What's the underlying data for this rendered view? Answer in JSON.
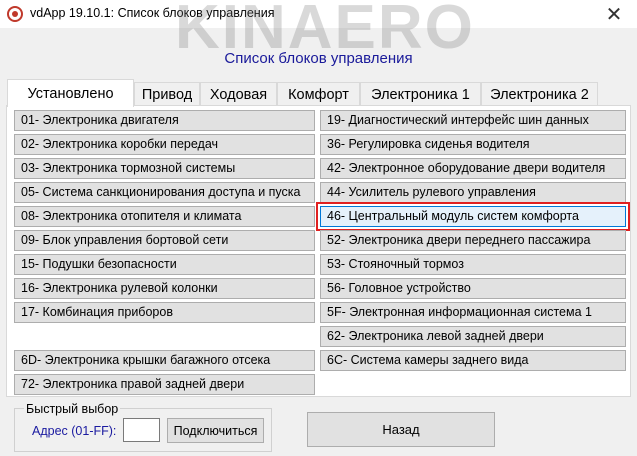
{
  "window": {
    "title": "vdApp 19.10.1:  Список блоков управления",
    "watermark": "KINAERO",
    "close_glyph": "✕"
  },
  "heading": "Список блоков управления",
  "tabs": [
    {
      "label": "Установлено",
      "active": true
    },
    {
      "label": "Привод",
      "active": false
    },
    {
      "label": "Ходовая",
      "active": false
    },
    {
      "label": "Комфорт",
      "active": false
    },
    {
      "label": "Электроника 1",
      "active": false
    },
    {
      "label": "Электроника 2",
      "active": false
    }
  ],
  "modules_left": [
    "01- Электроника двигателя",
    "02- Электроника коробки передач",
    "03- Электроника тормозной системы",
    "05- Система санкционирования доступа и пуска",
    "08- Электроника отопителя и климата",
    "09- Блок управления бортовой сети",
    "15- Подушки безопасности",
    "16- Электроника рулевой колонки",
    "17- Комбинация приборов",
    "6D- Электроника крышки багажного отсека",
    "72- Электроника правой задней двери"
  ],
  "modules_right": [
    "19- Диагностический интерфейс шин данных",
    "36- Регулировка сиденья водителя",
    "42- Электронное оборудование двери водителя",
    "44- Усилитель рулевого управления",
    "46- Центральный модуль систем комфорта",
    "52- Электроника двери переднего пассажира",
    "53- Стояночный тормоз",
    "56- Головное устройство",
    "5F- Электронная информационная система 1",
    "62- Электроника левой задней двери",
    "6C- Система камеры заднего вида"
  ],
  "selected_module": "46- Центральный модуль систем комфорта",
  "quick_select": {
    "title": "Быстрый выбор",
    "address_label": "Адрес (01-FF):",
    "address_value": "",
    "connect_label": "Подключиться"
  },
  "back_label": "Назад",
  "colors": {
    "heading": "#1a1a9a",
    "selection_outline": "#e02020",
    "selected_bg": "#e5f1fb"
  }
}
